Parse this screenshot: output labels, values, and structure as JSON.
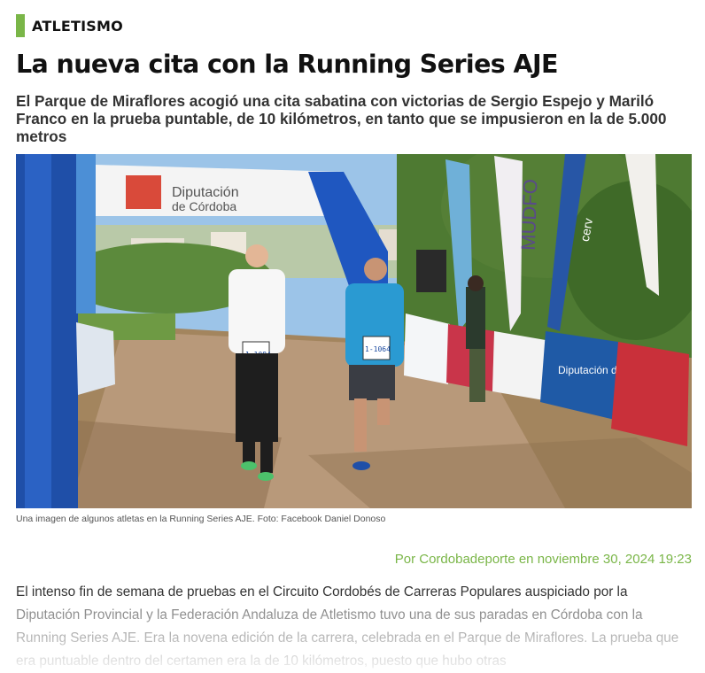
{
  "category": "ATLETISMO",
  "headline": "La nueva cita con la Running Series AJE",
  "subheadline": "El Parque de Miraflores acogió una cita sabatina con victorias de Sergio Espejo y Mariló Franco en la prueba puntable, de 10 kilómetros, en tanto que se impusieron en la de 5.000 metros",
  "photo": {
    "arch_text_line1": "Diputación",
    "arch_text_line2": "de Córdoba",
    "bib_left": "1-1084",
    "bib_right": "1-1064",
    "banner_text": "Diputación de Córdoba",
    "flag_text_1": "MUDFO",
    "flag_text_2": "cerv"
  },
  "caption": "Una imagen de algunos atletas en la Running Series AJE. Foto: Facebook Daniel Donoso",
  "byline": "Por Cordobadeporte en noviembre 30, 2024 19:23",
  "body": "El intenso fin de semana de pruebas en el Circuito Cordobés de Carreras Populares auspiciado por la Diputación Provincial y la Federación Andaluza de Atletismo tuvo una de sus paradas en Córdoba con la Running Series AJE. Era la novena edición de la carrera, celebrada en el Parque de Miraflores. La prueba que era puntuable dentro del certamen era la de 10 kilómetros, puesto que hubo otras",
  "colors": {
    "accent": "#7ab648",
    "byline": "#7ab648"
  }
}
